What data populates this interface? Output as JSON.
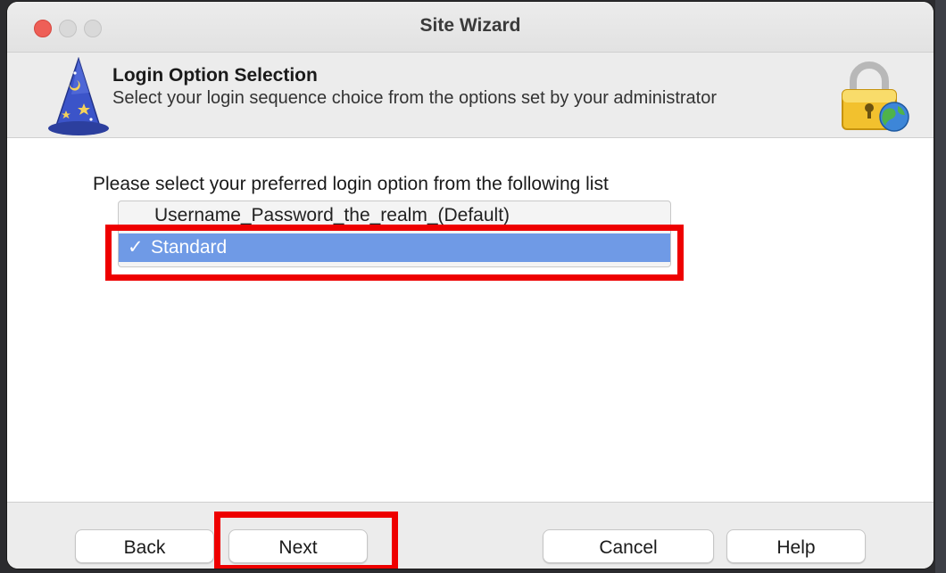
{
  "window": {
    "title": "Site Wizard"
  },
  "header": {
    "title": "Login Option Selection",
    "subtitle": "Select your login sequence choice from the options set by your administrator"
  },
  "content": {
    "prompt": "Please select your preferred  login option from the following list",
    "options": [
      {
        "label": "Username_Password_the_realm_(Default)",
        "selected": false
      },
      {
        "label": "Standard",
        "selected": true
      }
    ],
    "check_mark": "✓"
  },
  "buttons": {
    "back": "Back",
    "next": "Next",
    "cancel": "Cancel",
    "help": "Help"
  },
  "colors": {
    "highlight": "#ee0000",
    "selection": "#6f9ae6",
    "close_button": "#ee5f57"
  },
  "icons": [
    "wizard-hat-icon",
    "padlock-globe-icon"
  ]
}
